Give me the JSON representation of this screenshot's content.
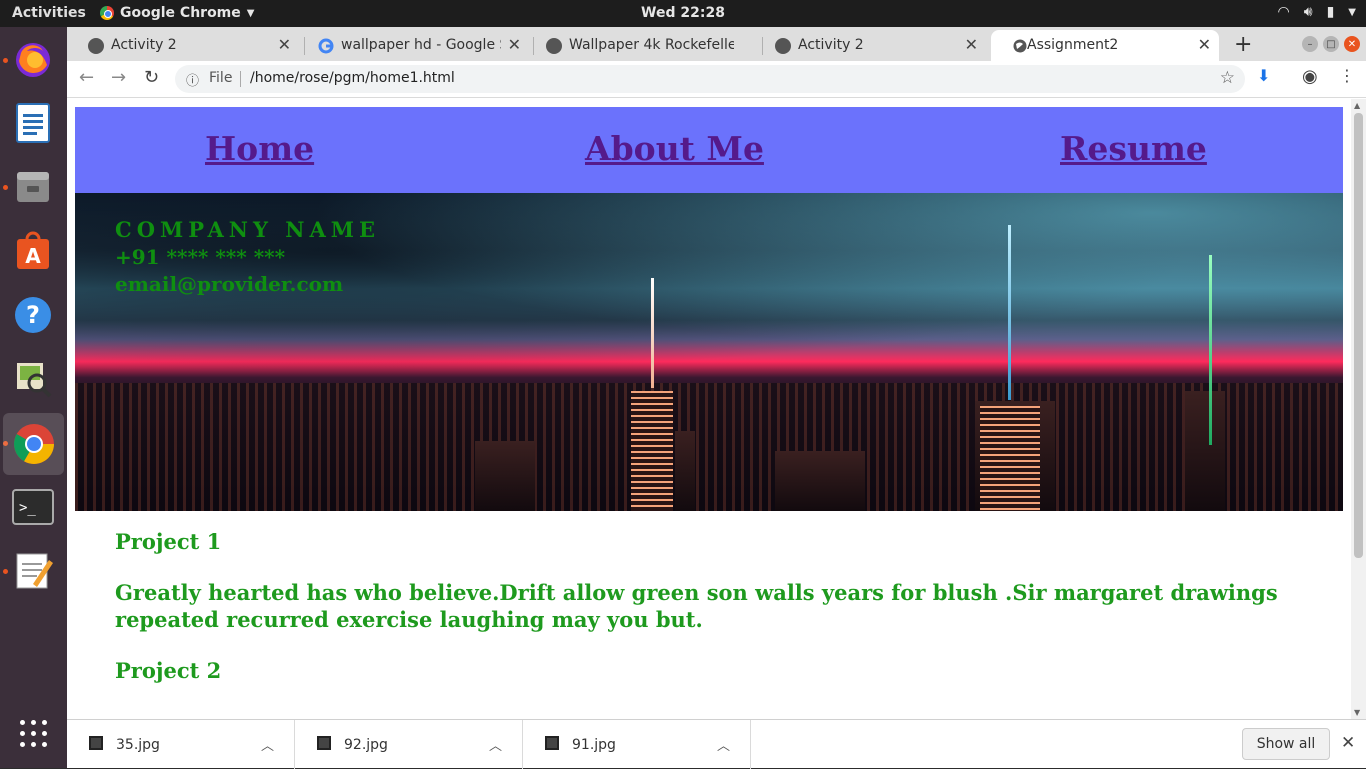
{
  "topbar": {
    "activities": "Activities",
    "app_name": "Google Chrome",
    "clock": "Wed 22:28"
  },
  "dock": {
    "apps": [
      "firefox-icon",
      "writer-icon",
      "files-icon",
      "software-icon",
      "help-icon",
      "image-viewer-icon",
      "chrome-icon",
      "terminal-icon",
      "text-editor-icon",
      "app-grid-icon"
    ]
  },
  "tabs": [
    {
      "title": "Activity 2"
    },
    {
      "title": "wallpaper hd - Google Se"
    },
    {
      "title": "Wallpaper 4k Rockefeller"
    },
    {
      "title": "Activity 2"
    },
    {
      "title": "Assignment2"
    }
  ],
  "omnibox": {
    "scheme_label": "File",
    "url": "/home/rose/pgm/home1.html"
  },
  "page": {
    "nav": {
      "home": "Home",
      "about": "About Me",
      "resume": "Resume"
    },
    "company": {
      "name": "COMPANY NAME",
      "phone": "+91 **** *** ***",
      "email": "email@provider.com"
    },
    "project1_title": "Project 1",
    "project1_text": "Greatly hearted has who believe.Drift allow green son walls years for blush .Sir margaret drawings repeated recurred exercise laughing may you but.",
    "project2_title": "Project 2"
  },
  "downloads": [
    {
      "name": "35.jpg"
    },
    {
      "name": "92.jpg"
    },
    {
      "name": "91.jpg"
    }
  ],
  "shelf": {
    "show_all": "Show all"
  }
}
